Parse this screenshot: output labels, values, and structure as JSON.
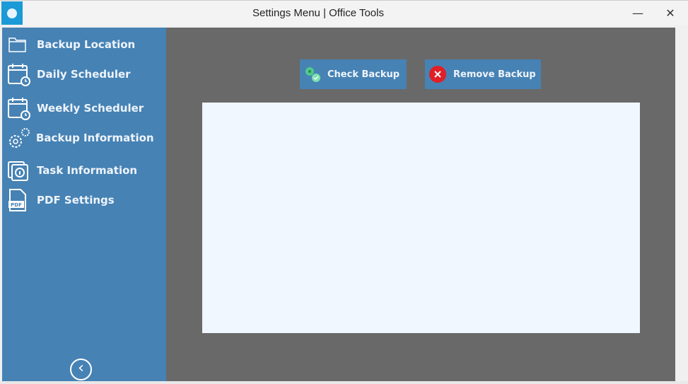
{
  "window": {
    "title": "Settings Menu | Office Tools",
    "minimize": "—",
    "close": "✕"
  },
  "sidebar": {
    "items": [
      {
        "label": "Backup Location",
        "icon": "folder-icon"
      },
      {
        "label": "Daily Scheduler",
        "icon": "calendar-clock-icon"
      },
      {
        "label": "Weekly Scheduler",
        "icon": "calendar-clock-icon"
      },
      {
        "label": "Backup Information",
        "icon": "gears-icon"
      },
      {
        "label": "Task Information",
        "icon": "info-document-icon"
      },
      {
        "label": "PDF Settings",
        "icon": "pdf-file-icon"
      }
    ],
    "collapse": "‹"
  },
  "main": {
    "check_backup": "Check Backup",
    "remove_backup": "Remove Backup"
  },
  "colors": {
    "sidebar": "#4682b4",
    "main": "#696969",
    "panel": "#f0f7ff"
  }
}
